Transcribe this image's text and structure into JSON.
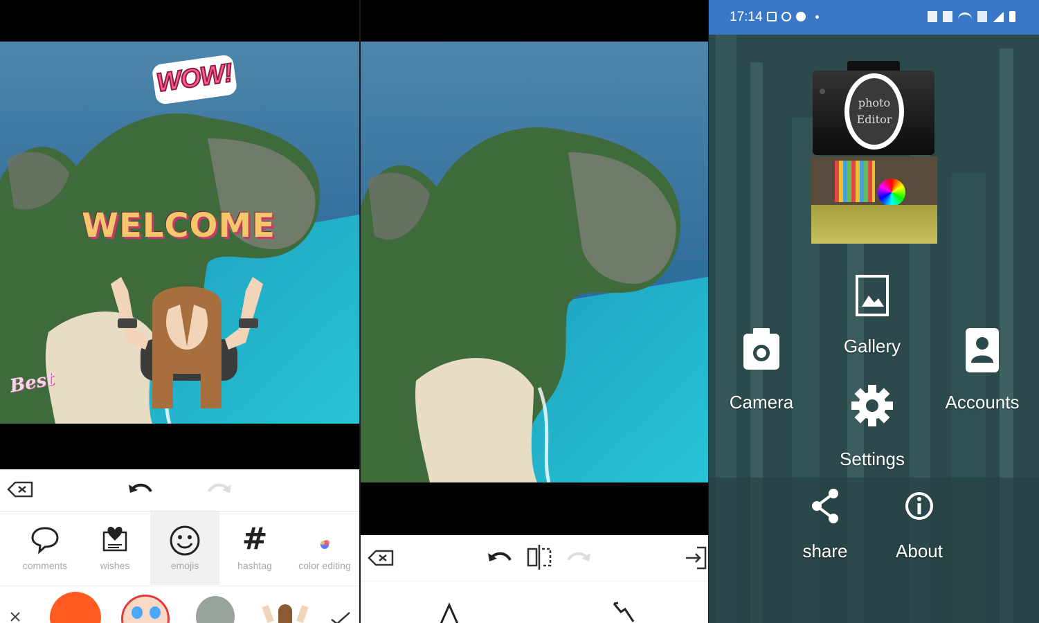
{
  "editor": {
    "stickers": {
      "wow": "WOW!",
      "welcome": "WELCOME",
      "best": "Best"
    },
    "tabs": [
      {
        "label": "comments",
        "icon": "speech-bubble-icon"
      },
      {
        "label": "wishes",
        "icon": "heart-card-icon"
      },
      {
        "label": "emojis",
        "icon": "smiley-icon",
        "active": true
      },
      {
        "label": "hashtag",
        "icon": "hashtag-icon"
      },
      {
        "label": "color editing",
        "icon": "color-dot-icon"
      }
    ],
    "emoji_row": [
      "close-icon",
      "angry-emoji",
      "clown-emoji",
      "alien-emoji",
      "rocker-sticker",
      "check-icon"
    ]
  },
  "launcher": {
    "status": {
      "time": "17:14"
    },
    "logo": {
      "line1": "photo",
      "line2": "Editor"
    },
    "items": {
      "gallery": "Gallery",
      "camera": "Camera",
      "accounts": "Accounts",
      "settings": "Settings",
      "share": "share",
      "about": "About"
    }
  },
  "colors": {
    "sea": "#2e6d9a",
    "lagoon": "#1fb2c9",
    "cliff_green": "#3d6b3a",
    "status_bar": "#3a78c7",
    "launcher_bg": "#2c4a4c"
  }
}
